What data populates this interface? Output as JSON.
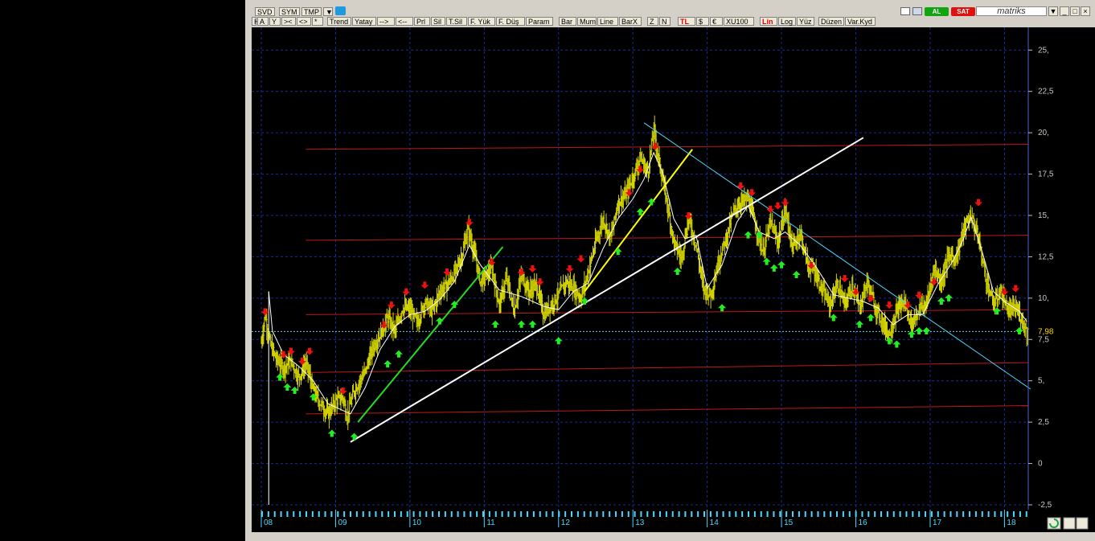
{
  "toolbar": {
    "row1": [
      "SVD",
      "SYM",
      "TMP",
      "▼"
    ],
    "row2": [
      "H",
      "A",
      "Y",
      "><",
      "<>",
      "*",
      "Trend",
      "Yatay",
      "-->",
      "<--",
      "Prl",
      "Sil",
      "T.Sil",
      "F. Yük",
      "F. Düş",
      "Param",
      "Bar",
      "Mum",
      "Line",
      "BarX",
      "Z",
      "N",
      "TL",
      "$",
      "€",
      "XU100",
      "Lin",
      "Log",
      "Yüz",
      "Düzen",
      "Var.Kyd"
    ],
    "red_labels": [
      "TL",
      "Lin"
    ],
    "buy_label": "AL",
    "sell_label": "SAT",
    "brand": "matriks",
    "buy_color": "#13a50f",
    "sell_color": "#e01010",
    "twitter_icon": "bird-icon",
    "window_controls": [
      "minimize-icon",
      "restore-icon",
      "close-icon"
    ]
  },
  "chart_data": {
    "type": "line",
    "style": "ohlc-bars-with-indicators",
    "background": "#000000",
    "ylim": [
      -2.5,
      25.5
    ],
    "y_ticks": [
      "25,",
      "22,5",
      "20,",
      "17,5",
      "15,",
      "12,5",
      "10,",
      "7,5",
      "5,",
      "2,5",
      "0",
      "-2,5"
    ],
    "x_year_labels": [
      "08",
      "09",
      "10",
      "11",
      "12",
      "13",
      "14",
      "15",
      "16",
      "17",
      "18"
    ],
    "last_value_label": "7,98",
    "last_value": 7.98,
    "bar_color": "#d6d600",
    "price_path": [
      [
        2008.0,
        7.3
      ],
      [
        2008.05,
        9.0
      ],
      [
        2008.12,
        7.2
      ],
      [
        2008.2,
        6.3
      ],
      [
        2008.3,
        5.8
      ],
      [
        2008.4,
        6.2
      ],
      [
        2008.5,
        5.2
      ],
      [
        2008.6,
        6.1
      ],
      [
        2008.7,
        4.4
      ],
      [
        2008.8,
        3.6
      ],
      [
        2008.9,
        3.0
      ],
      [
        2009.0,
        3.8
      ],
      [
        2009.1,
        4.0
      ],
      [
        2009.15,
        2.8
      ],
      [
        2009.25,
        4.4
      ],
      [
        2009.4,
        5.6
      ],
      [
        2009.5,
        7.0
      ],
      [
        2009.6,
        7.8
      ],
      [
        2009.7,
        8.8
      ],
      [
        2009.8,
        8.0
      ],
      [
        2009.9,
        9.4
      ],
      [
        2010.0,
        9.3
      ],
      [
        2010.1,
        8.5
      ],
      [
        2010.2,
        9.8
      ],
      [
        2010.3,
        9.2
      ],
      [
        2010.4,
        10.4
      ],
      [
        2010.5,
        10.8
      ],
      [
        2010.6,
        11.5
      ],
      [
        2010.7,
        12.6
      ],
      [
        2010.78,
        14.2
      ],
      [
        2010.85,
        13.0
      ],
      [
        2010.95,
        11.0
      ],
      [
        2011.1,
        11.8
      ],
      [
        2011.2,
        9.6
      ],
      [
        2011.3,
        11.2
      ],
      [
        2011.4,
        9.2
      ],
      [
        2011.5,
        11.4
      ],
      [
        2011.6,
        10.4
      ],
      [
        2011.7,
        10.8
      ],
      [
        2011.8,
        9.0
      ],
      [
        2011.9,
        9.6
      ],
      [
        2012.0,
        10.2
      ],
      [
        2012.1,
        11.0
      ],
      [
        2012.2,
        10.6
      ],
      [
        2012.3,
        10.0
      ],
      [
        2012.4,
        11.6
      ],
      [
        2012.5,
        13.4
      ],
      [
        2012.6,
        14.8
      ],
      [
        2012.7,
        13.6
      ],
      [
        2012.8,
        15.8
      ],
      [
        2012.9,
        16.2
      ],
      [
        2013.0,
        17.3
      ],
      [
        2013.1,
        18.5
      ],
      [
        2013.2,
        17.6
      ],
      [
        2013.28,
        20.2
      ],
      [
        2013.35,
        18.3
      ],
      [
        2013.45,
        16.0
      ],
      [
        2013.55,
        13.4
      ],
      [
        2013.65,
        12.4
      ],
      [
        2013.75,
        14.8
      ],
      [
        2013.85,
        13.2
      ],
      [
        2013.95,
        10.6
      ],
      [
        2014.05,
        10.2
      ],
      [
        2014.15,
        12.2
      ],
      [
        2014.25,
        13.6
      ],
      [
        2014.35,
        15.2
      ],
      [
        2014.45,
        15.8
      ],
      [
        2014.55,
        16.0
      ],
      [
        2014.65,
        14.4
      ],
      [
        2014.75,
        12.8
      ],
      [
        2014.85,
        14.6
      ],
      [
        2014.95,
        13.4
      ],
      [
        2015.05,
        15.4
      ],
      [
        2015.15,
        13.0
      ],
      [
        2015.25,
        14.0
      ],
      [
        2015.35,
        12.0
      ],
      [
        2015.45,
        11.6
      ],
      [
        2015.55,
        10.4
      ],
      [
        2015.65,
        9.6
      ],
      [
        2015.75,
        10.8
      ],
      [
        2015.85,
        9.6
      ],
      [
        2015.95,
        10.8
      ],
      [
        2016.05,
        9.4
      ],
      [
        2016.15,
        11.0
      ],
      [
        2016.25,
        9.6
      ],
      [
        2016.35,
        8.6
      ],
      [
        2016.45,
        7.8
      ],
      [
        2016.55,
        9.2
      ],
      [
        2016.65,
        9.8
      ],
      [
        2016.75,
        8.4
      ],
      [
        2016.85,
        9.4
      ],
      [
        2016.95,
        9.6
      ],
      [
        2017.05,
        11.8
      ],
      [
        2017.15,
        11.0
      ],
      [
        2017.25,
        12.6
      ],
      [
        2017.35,
        12.4
      ],
      [
        2017.45,
        14.2
      ],
      [
        2017.55,
        15.0
      ],
      [
        2017.65,
        13.6
      ],
      [
        2017.75,
        11.2
      ],
      [
        2017.85,
        9.6
      ],
      [
        2017.95,
        10.4
      ],
      [
        2018.05,
        9.2
      ],
      [
        2018.15,
        9.4
      ],
      [
        2018.25,
        8.6
      ],
      [
        2018.3,
        7.98
      ]
    ],
    "indicator_path": [
      [
        2008.1,
        10.4
      ],
      [
        2008.15,
        8.0
      ],
      [
        2008.3,
        6.6
      ],
      [
        2008.5,
        5.9
      ],
      [
        2008.7,
        5.0
      ],
      [
        2008.9,
        3.6
      ],
      [
        2009.1,
        3.2
      ],
      [
        2009.2,
        3.0
      ],
      [
        2009.4,
        4.6
      ],
      [
        2009.6,
        6.9
      ],
      [
        2009.8,
        8.3
      ],
      [
        2010.0,
        9.0
      ],
      [
        2010.2,
        9.2
      ],
      [
        2010.4,
        9.9
      ],
      [
        2010.6,
        11.0
      ],
      [
        2010.8,
        13.2
      ],
      [
        2010.95,
        12.0
      ],
      [
        2011.2,
        10.5
      ],
      [
        2011.5,
        10.1
      ],
      [
        2011.8,
        9.5
      ],
      [
        2012.0,
        9.3
      ],
      [
        2012.2,
        10.4
      ],
      [
        2012.4,
        10.9
      ],
      [
        2012.6,
        13.0
      ],
      [
        2012.8,
        14.8
      ],
      [
        2013.0,
        16.0
      ],
      [
        2013.15,
        17.2
      ],
      [
        2013.28,
        18.8
      ],
      [
        2013.4,
        17.6
      ],
      [
        2013.55,
        14.8
      ],
      [
        2013.7,
        13.6
      ],
      [
        2013.85,
        13.8
      ],
      [
        2014.0,
        10.6
      ],
      [
        2014.2,
        12.0
      ],
      [
        2014.4,
        14.6
      ],
      [
        2014.55,
        15.6
      ],
      [
        2014.7,
        14.0
      ],
      [
        2014.9,
        13.6
      ],
      [
        2015.05,
        14.0
      ],
      [
        2015.25,
        13.2
      ],
      [
        2015.45,
        12.0
      ],
      [
        2015.7,
        10.2
      ],
      [
        2015.9,
        10.0
      ],
      [
        2016.1,
        9.8
      ],
      [
        2016.3,
        9.4
      ],
      [
        2016.5,
        8.4
      ],
      [
        2016.7,
        9.0
      ],
      [
        2016.9,
        9.0
      ],
      [
        2017.1,
        10.8
      ],
      [
        2017.3,
        12.2
      ],
      [
        2017.45,
        13.6
      ],
      [
        2017.55,
        14.9
      ],
      [
        2017.7,
        12.8
      ],
      [
        2017.85,
        10.4
      ],
      [
        2018.0,
        9.8
      ],
      [
        2018.2,
        9.2
      ],
      [
        2018.3,
        8.6
      ]
    ],
    "horizontal_levels": [
      {
        "y_start": 3.0,
        "y_end": 3.5
      },
      {
        "y_start": 5.5,
        "y_end": 6.1
      },
      {
        "y_start": 9.0,
        "y_end": 9.3
      },
      {
        "y_start": 13.5,
        "y_end": 13.8
      },
      {
        "y_start": 19.0,
        "y_end": 19.3
      }
    ],
    "trend_lines": [
      {
        "name": "support-white",
        "color": "#ffffff",
        "from": [
          2009.2,
          1.3
        ],
        "to": [
          2016.1,
          19.7
        ]
      },
      {
        "name": "up-green",
        "color": "#22dd22",
        "from": [
          2009.3,
          2.5
        ],
        "to": [
          2011.25,
          13.1
        ]
      },
      {
        "name": "up-yellow",
        "color": "#ffff00",
        "from": [
          2012.35,
          10.4
        ],
        "to": [
          2013.8,
          19.0
        ]
      },
      {
        "name": "down-cyan",
        "color": "#4fd6ff",
        "from": [
          2013.15,
          20.6
        ],
        "to": [
          2018.35,
          4.5
        ]
      }
    ],
    "buy_signals": [
      [
        2008.25,
        5.2
      ],
      [
        2008.35,
        4.6
      ],
      [
        2008.45,
        4.4
      ],
      [
        2008.7,
        4.0
      ],
      [
        2008.95,
        1.8
      ],
      [
        2009.25,
        1.6
      ],
      [
        2009.7,
        6.0
      ],
      [
        2009.85,
        6.6
      ],
      [
        2010.4,
        8.6
      ],
      [
        2010.6,
        9.6
      ],
      [
        2011.15,
        8.4
      ],
      [
        2011.5,
        8.4
      ],
      [
        2011.65,
        8.4
      ],
      [
        2012.0,
        7.4
      ],
      [
        2012.35,
        9.8
      ],
      [
        2012.8,
        12.8
      ],
      [
        2013.1,
        15.2
      ],
      [
        2013.25,
        15.8
      ],
      [
        2013.6,
        11.6
      ],
      [
        2014.2,
        9.4
      ],
      [
        2014.55,
        13.8
      ],
      [
        2014.7,
        13.8
      ],
      [
        2014.8,
        12.2
      ],
      [
        2014.9,
        11.8
      ],
      [
        2015.0,
        12.0
      ],
      [
        2015.2,
        11.4
      ],
      [
        2015.7,
        8.8
      ],
      [
        2016.05,
        8.4
      ],
      [
        2016.2,
        8.8
      ],
      [
        2016.45,
        7.4
      ],
      [
        2016.55,
        7.2
      ],
      [
        2016.75,
        7.8
      ],
      [
        2016.85,
        8.0
      ],
      [
        2016.95,
        8.0
      ],
      [
        2017.15,
        9.8
      ],
      [
        2017.25,
        10.0
      ],
      [
        2017.9,
        9.2
      ],
      [
        2018.2,
        8.0
      ]
    ],
    "sell_signals": [
      [
        2008.05,
        9.2
      ],
      [
        2008.3,
        6.6
      ],
      [
        2008.4,
        6.8
      ],
      [
        2008.55,
        6.2
      ],
      [
        2008.65,
        6.8
      ],
      [
        2009.1,
        4.4
      ],
      [
        2009.65,
        8.4
      ],
      [
        2009.75,
        9.6
      ],
      [
        2009.95,
        10.4
      ],
      [
        2010.2,
        10.8
      ],
      [
        2010.5,
        11.6
      ],
      [
        2010.8,
        14.6
      ],
      [
        2011.1,
        12.2
      ],
      [
        2011.5,
        11.6
      ],
      [
        2011.65,
        11.8
      ],
      [
        2011.75,
        11.0
      ],
      [
        2012.15,
        11.8
      ],
      [
        2012.3,
        12.4
      ],
      [
        2012.95,
        16.4
      ],
      [
        2013.1,
        17.8
      ],
      [
        2013.3,
        19.2
      ],
      [
        2013.75,
        15.0
      ],
      [
        2014.45,
        16.8
      ],
      [
        2014.6,
        16.4
      ],
      [
        2014.85,
        15.4
      ],
      [
        2014.95,
        15.6
      ],
      [
        2015.05,
        15.8
      ],
      [
        2015.4,
        12.0
      ],
      [
        2015.85,
        11.2
      ],
      [
        2016.0,
        10.4
      ],
      [
        2016.2,
        10.0
      ],
      [
        2016.45,
        9.6
      ],
      [
        2016.7,
        9.6
      ],
      [
        2016.85,
        10.2
      ],
      [
        2017.05,
        11.0
      ],
      [
        2017.65,
        15.8
      ],
      [
        2018.0,
        10.4
      ],
      [
        2018.15,
        10.6
      ]
    ]
  }
}
